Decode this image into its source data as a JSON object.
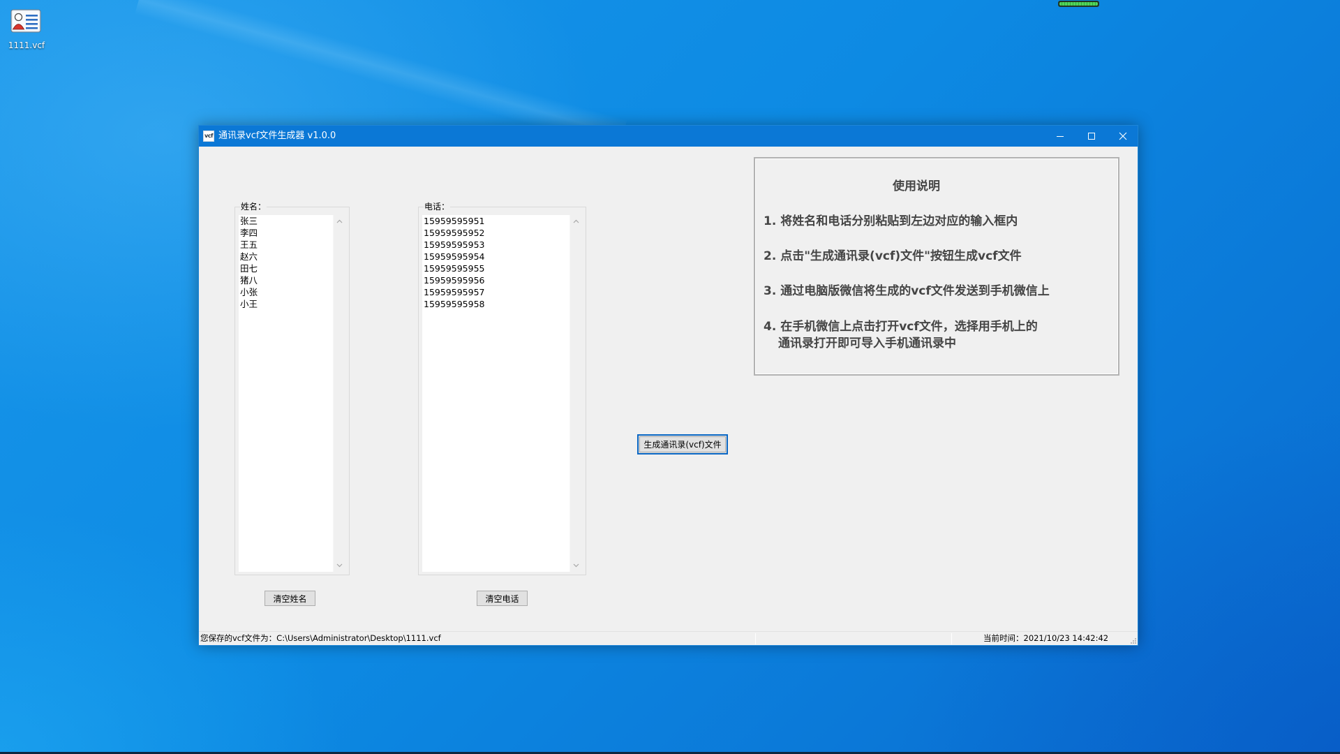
{
  "desktop": {
    "icons": [
      {
        "label": "1111.vcf",
        "icon": "vcf-contact-file-icon"
      }
    ]
  },
  "top_indicator": {
    "level": 1.0
  },
  "window": {
    "title": "通讯录vcf文件生成器 v1.0.0",
    "app_icon_text": "vcf",
    "controls": {
      "minimize": "minimize-icon",
      "maximize": "maximize-icon",
      "close": "close-icon"
    }
  },
  "names": {
    "label": "姓名：",
    "items": [
      "张三",
      "李四",
      "王五",
      "赵六",
      "田七",
      "猪八",
      "小张",
      "小王"
    ]
  },
  "phones": {
    "label": "电话：",
    "items": [
      "15959595951",
      "15959595952",
      "15959595953",
      "15959595954",
      "15959595955",
      "15959595956",
      "15959595957",
      "15959595958"
    ]
  },
  "buttons": {
    "clear_names": "清空姓名",
    "clear_phones": "清空电话",
    "generate": "生成通讯录(vcf)文件"
  },
  "instructions": {
    "title": "使用说明",
    "lines": [
      "1. 将姓名和电话分别粘贴到左边对应的输入框内",
      "2. 点击\"生成通讯录(vcf)文件\"按钮生成vcf文件",
      "3. 通过电脑版微信将生成的vcf文件发送到手机微信上",
      "4. 在手机微信上点击打开vcf文件，选择用手机上的",
      "通讯录打开即可导入手机通讯录中"
    ]
  },
  "status_bar": {
    "save_path": "您保存的vcf文件为：C:\\Users\\Administrator\\Desktop\\1111.vcf",
    "current_time": "当前时间：2021/10/23 14:42:42"
  },
  "colors": {
    "title_bar": "#0b78d6",
    "default_button_border": "#0a67c4",
    "desktop": "#0d8ae3"
  }
}
